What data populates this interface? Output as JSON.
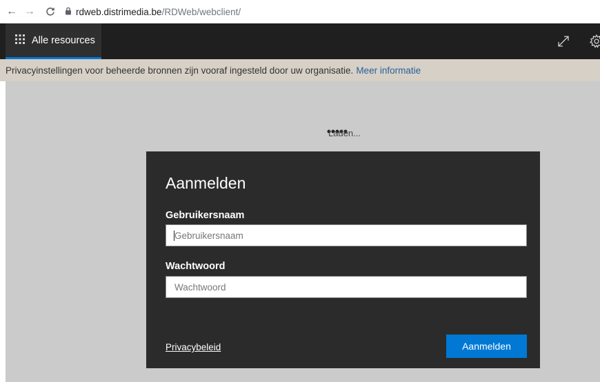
{
  "browser": {
    "url_host": "rdweb.distrimedia.be",
    "url_path": "/RDWeb/webclient/",
    "back_icon": "←",
    "forward_icon": "→",
    "reload_icon": "C"
  },
  "header": {
    "all_resources_label": "Alle resources"
  },
  "banner": {
    "message": "Privacyinstellingen voor beheerde bronnen zijn vooraf ingesteld door uw organisatie.",
    "link_text": "Meer informatie"
  },
  "loading": {
    "text": "Laden..."
  },
  "login": {
    "title": "Aanmelden",
    "username_label": "Gebruikersnaam",
    "username_placeholder": "Gebruikersnaam",
    "password_label": "Wachtwoord",
    "password_placeholder": "Wachtwoord",
    "privacy_link": "Privacybeleid",
    "submit_label": "Aanmelden"
  },
  "colors": {
    "accent": "#0078d4",
    "header_bg": "#1f1f1f",
    "dialog_bg": "#2b2b2b",
    "banner_bg": "#d6d0c6",
    "content_bg": "#cbcbcb"
  }
}
